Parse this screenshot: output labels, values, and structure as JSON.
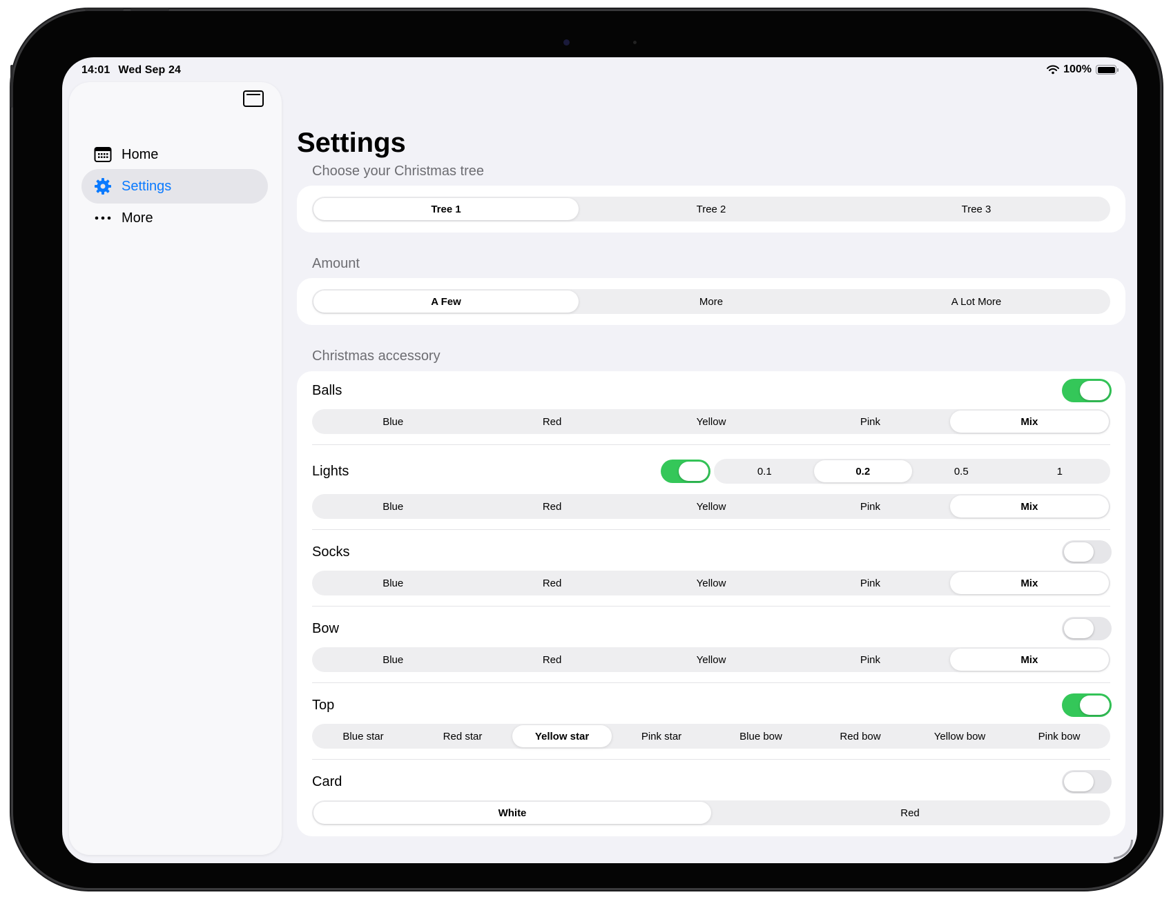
{
  "status_bar": {
    "time": "14:01",
    "date": "Wed Sep 24",
    "battery": "100%"
  },
  "sidebar": {
    "items": [
      {
        "label": "Home",
        "icon": "calendar-icon",
        "active": false
      },
      {
        "label": "Settings",
        "icon": "gear-icon",
        "active": true
      },
      {
        "label": "More",
        "icon": "ellipsis-icon",
        "active": false
      }
    ]
  },
  "main": {
    "title": "Settings",
    "tree": {
      "header": "Choose your Christmas tree",
      "options": [
        "Tree 1",
        "Tree 2",
        "Tree 3"
      ],
      "selected": 0
    },
    "amount": {
      "header": "Amount",
      "options": [
        "A Few",
        "More",
        "A Lot More"
      ],
      "selected": 0
    },
    "accessory": {
      "header": "Christmas accessory",
      "balls": {
        "label": "Balls",
        "enabled": true,
        "colors": [
          "Blue",
          "Red",
          "Yellow",
          "Pink",
          "Mix"
        ],
        "selected": 4
      },
      "lights": {
        "label": "Lights",
        "enabled": true,
        "levels": [
          "0.1",
          "0.2",
          "0.5",
          "1"
        ],
        "level_selected": 1,
        "colors": [
          "Blue",
          "Red",
          "Yellow",
          "Pink",
          "Mix"
        ],
        "selected": 4
      },
      "socks": {
        "label": "Socks",
        "enabled": false,
        "colors": [
          "Blue",
          "Red",
          "Yellow",
          "Pink",
          "Mix"
        ],
        "selected": 4
      },
      "bow": {
        "label": "Bow",
        "enabled": false,
        "colors": [
          "Blue",
          "Red",
          "Yellow",
          "Pink",
          "Mix"
        ],
        "selected": 4
      },
      "top": {
        "label": "Top",
        "enabled": true,
        "options": [
          "Blue star",
          "Red star",
          "Yellow star",
          "Pink star",
          "Blue bow",
          "Red bow",
          "Yellow bow",
          "Pink bow"
        ],
        "selected": 2
      },
      "card": {
        "label": "Card",
        "enabled": false,
        "options": [
          "White",
          "Red"
        ],
        "selected": 0
      }
    }
  },
  "colors": {
    "accent": "#0a7aff",
    "toggle_on": "#34c759",
    "background": "#f2f2f7"
  }
}
